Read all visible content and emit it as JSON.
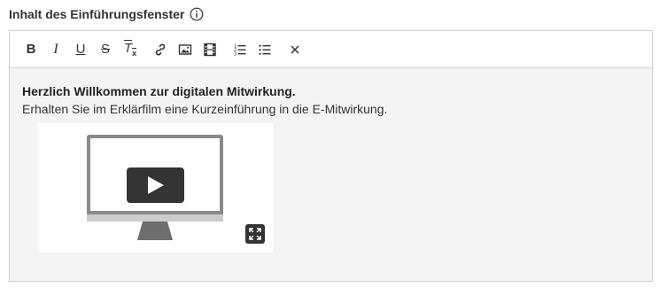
{
  "field": {
    "label": "Inhalt des Einführungsfenster",
    "info_icon": "info-circle-icon"
  },
  "toolbar": {
    "bold_label": "B",
    "italic_label": "I",
    "underline_label": "U",
    "strike_label": "S",
    "clear_format_label": "T",
    "clear_format_sub": "x",
    "icons": [
      "bold-icon",
      "italic-icon",
      "underline-icon",
      "strikethrough-icon",
      "clear-format-icon",
      "link-icon",
      "image-icon",
      "video-icon",
      "ordered-list-icon",
      "unordered-list-icon",
      "close-icon"
    ]
  },
  "content": {
    "heading": "Herzlich Willkommen zur digitalen Mitwirkung.",
    "text": "Erhalten Sie im Erklärfilm eine Kurzeinführung in die E-Mitwirkung."
  },
  "video": {
    "icon": "monitor-play-icon",
    "fullscreen_icon": "fullscreen-icon"
  },
  "colors": {
    "content_bg": "#f4f4f4",
    "border": "#cfcfcf",
    "monitor_frame": "#888888",
    "play_button": "#333333"
  }
}
